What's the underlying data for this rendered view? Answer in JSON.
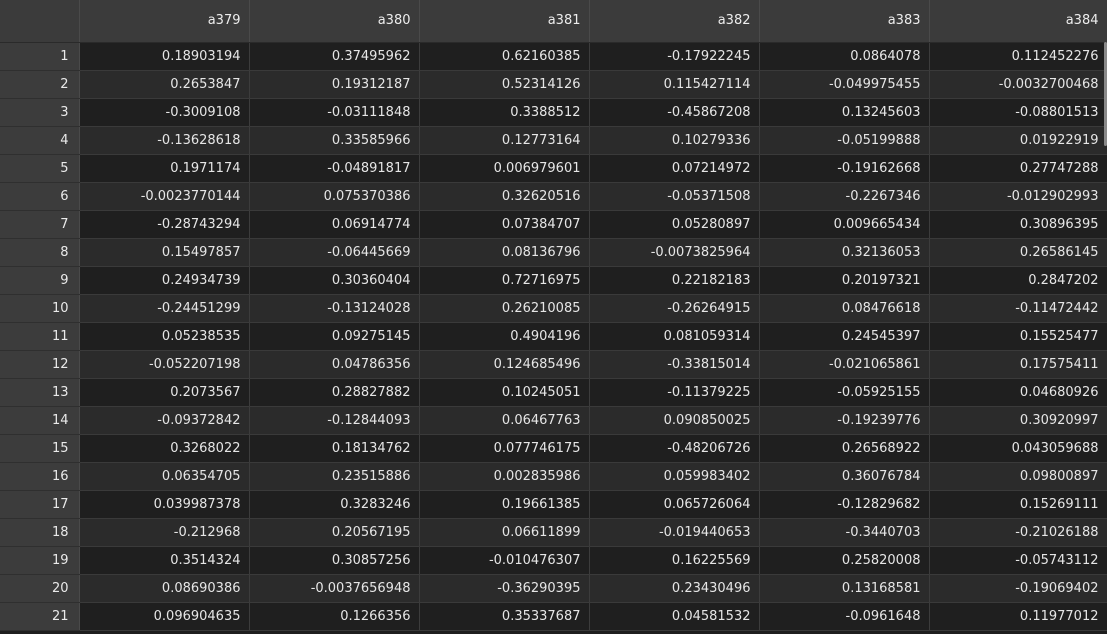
{
  "columns": [
    "a379",
    "a380",
    "a381",
    "a382",
    "a383",
    "a384"
  ],
  "rows": [
    {
      "index": "1",
      "cells": [
        "0.18903194",
        "0.37495962",
        "0.62160385",
        "-0.17922245",
        "0.0864078",
        "0.112452276"
      ]
    },
    {
      "index": "2",
      "cells": [
        "0.2653847",
        "0.19312187",
        "0.52314126",
        "0.115427114",
        "-0.049975455",
        "-0.0032700468"
      ]
    },
    {
      "index": "3",
      "cells": [
        "-0.3009108",
        "-0.03111848",
        "0.3388512",
        "-0.45867208",
        "0.13245603",
        "-0.08801513"
      ]
    },
    {
      "index": "4",
      "cells": [
        "-0.13628618",
        "0.33585966",
        "0.12773164",
        "0.10279336",
        "-0.05199888",
        "0.01922919"
      ]
    },
    {
      "index": "5",
      "cells": [
        "0.1971174",
        "-0.04891817",
        "0.006979601",
        "0.07214972",
        "-0.19162668",
        "0.27747288"
      ]
    },
    {
      "index": "6",
      "cells": [
        "-0.0023770144",
        "0.075370386",
        "0.32620516",
        "-0.05371508",
        "-0.2267346",
        "-0.012902993"
      ]
    },
    {
      "index": "7",
      "cells": [
        "-0.28743294",
        "0.06914774",
        "0.07384707",
        "0.05280897",
        "0.009665434",
        "0.30896395"
      ]
    },
    {
      "index": "8",
      "cells": [
        "0.15497857",
        "-0.06445669",
        "0.08136796",
        "-0.0073825964",
        "0.32136053",
        "0.26586145"
      ]
    },
    {
      "index": "9",
      "cells": [
        "0.24934739",
        "0.30360404",
        "0.72716975",
        "0.22182183",
        "0.20197321",
        "0.2847202"
      ]
    },
    {
      "index": "10",
      "cells": [
        "-0.24451299",
        "-0.13124028",
        "0.26210085",
        "-0.26264915",
        "0.08476618",
        "-0.11472442"
      ]
    },
    {
      "index": "11",
      "cells": [
        "0.05238535",
        "0.09275145",
        "0.4904196",
        "0.081059314",
        "0.24545397",
        "0.15525477"
      ]
    },
    {
      "index": "12",
      "cells": [
        "-0.052207198",
        "0.04786356",
        "0.124685496",
        "-0.33815014",
        "-0.021065861",
        "0.17575411"
      ]
    },
    {
      "index": "13",
      "cells": [
        "0.2073567",
        "0.28827882",
        "0.10245051",
        "-0.11379225",
        "-0.05925155",
        "0.04680926"
      ]
    },
    {
      "index": "14",
      "cells": [
        "-0.09372842",
        "-0.12844093",
        "0.06467763",
        "0.090850025",
        "-0.19239776",
        "0.30920997"
      ]
    },
    {
      "index": "15",
      "cells": [
        "0.3268022",
        "0.18134762",
        "0.077746175",
        "-0.48206726",
        "0.26568922",
        "0.043059688"
      ]
    },
    {
      "index": "16",
      "cells": [
        "0.06354705",
        "0.23515886",
        "0.002835986",
        "0.059983402",
        "0.36076784",
        "0.09800897"
      ]
    },
    {
      "index": "17",
      "cells": [
        "0.039987378",
        "0.3283246",
        "0.19661385",
        "0.065726064",
        "-0.12829682",
        "0.15269111"
      ]
    },
    {
      "index": "18",
      "cells": [
        "-0.212968",
        "0.20567195",
        "0.06611899",
        "-0.019440653",
        "-0.3440703",
        "-0.21026188"
      ]
    },
    {
      "index": "19",
      "cells": [
        "0.3514324",
        "0.30857256",
        "-0.010476307",
        "0.16225569",
        "0.25820008",
        "-0.05743112"
      ]
    },
    {
      "index": "20",
      "cells": [
        "0.08690386",
        "-0.0037656948",
        "-0.36290395",
        "0.23430496",
        "0.13168581",
        "-0.19069402"
      ]
    },
    {
      "index": "21",
      "cells": [
        "0.096904635",
        "0.1266356",
        "0.35337687",
        "0.04581532",
        "-0.0961648",
        "0.11977012"
      ]
    }
  ]
}
